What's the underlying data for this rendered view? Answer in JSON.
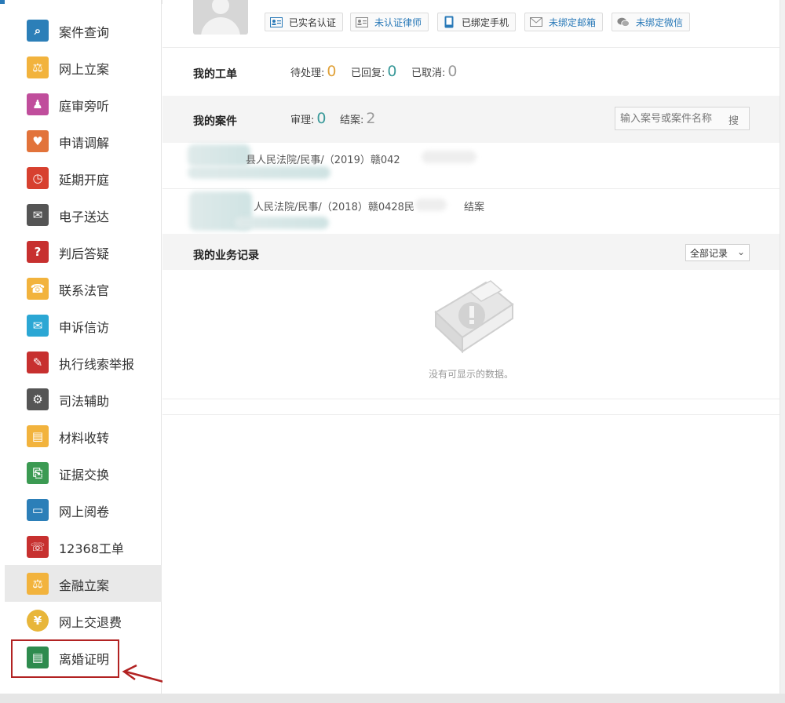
{
  "sidebar": {
    "items": [
      {
        "label": "案件查询",
        "icon": "magnifier-book-icon",
        "color": "#2c7fb8",
        "glyph": "⌕"
      },
      {
        "label": "网上立案",
        "icon": "gavel-icon",
        "color": "#f2b33d",
        "glyph": "⚖"
      },
      {
        "label": "庭审旁听",
        "icon": "audience-icon",
        "color": "#c04e9c",
        "glyph": "♟"
      },
      {
        "label": "申请调解",
        "icon": "handshake-heart-icon",
        "color": "#e2733a",
        "glyph": "♥"
      },
      {
        "label": "延期开庭",
        "icon": "clock-icon",
        "color": "#d7402f",
        "glyph": "◷"
      },
      {
        "label": "电子送达",
        "icon": "delivery-icon",
        "color": "#555555",
        "glyph": "✉"
      },
      {
        "label": "判后答疑",
        "icon": "question-icon",
        "color": "#c7302f",
        "glyph": "?"
      },
      {
        "label": "联系法官",
        "icon": "phone-icon",
        "color": "#f2b33d",
        "glyph": "☎"
      },
      {
        "label": "申诉信访",
        "icon": "mail-icon",
        "color": "#2ba7d4",
        "glyph": "✉"
      },
      {
        "label": "执行线索举报",
        "icon": "report-icon",
        "color": "#c7302f",
        "glyph": "✎"
      },
      {
        "label": "司法辅助",
        "icon": "assist-icon",
        "color": "#555555",
        "glyph": "⚙"
      },
      {
        "label": "材料收转",
        "icon": "materials-icon",
        "color": "#f2b33d",
        "glyph": "▤"
      },
      {
        "label": "证据交换",
        "icon": "evidence-icon",
        "color": "#3b9a52",
        "glyph": "⎘"
      },
      {
        "label": "网上阅卷",
        "icon": "monitor-icon",
        "color": "#2c7fb8",
        "glyph": "▭"
      },
      {
        "label": "12368工单",
        "icon": "hotline-icon",
        "color": "#c7302f",
        "glyph": "☏"
      },
      {
        "label": "金融立案",
        "icon": "gavel-finance-icon",
        "color": "#f2b33d",
        "glyph": "⚖"
      },
      {
        "label": "网上交退费",
        "icon": "coin-icon",
        "color": "#e8b63a",
        "glyph": "¥"
      },
      {
        "label": "离婚证明",
        "icon": "certificate-icon",
        "color": "#2e8b4e",
        "glyph": "▤"
      }
    ],
    "active_index": 15,
    "highlighted_index": 17
  },
  "header": {
    "badges": [
      {
        "label": "已实名认证",
        "icon": "id-card-icon",
        "state": "on"
      },
      {
        "label": "未认证律师",
        "icon": "lawyer-card-icon",
        "state": "off"
      },
      {
        "label": "已绑定手机",
        "icon": "phone-device-icon",
        "state": "on"
      },
      {
        "label": "未绑定邮箱",
        "icon": "envelope-icon",
        "state": "off"
      },
      {
        "label": "未绑定微信",
        "icon": "wechat-icon",
        "state": "off"
      }
    ]
  },
  "work_orders": {
    "title": "我的工单",
    "pending_label": "待处理:",
    "pending_value": "0",
    "replied_label": "已回复:",
    "replied_value": "0",
    "cancelled_label": "已取消:",
    "cancelled_value": "0"
  },
  "cases": {
    "title": "我的案件",
    "trial_label": "审理:",
    "trial_value": "0",
    "closed_label": "结案:",
    "closed_value": "2",
    "search_placeholder": "输入案号或案件名称",
    "search_button": "搜",
    "items": [
      {
        "text": "县人民法院/民事/（2019）赣042"
      },
      {
        "text": "人民法院/民事/（2018）赣0428民"
      },
      {
        "suffix": "结案"
      }
    ]
  },
  "records": {
    "title": "我的业务记录",
    "filter_value": "全部记录",
    "empty_text": "没有可显示的数据。"
  },
  "colors": {
    "accent_blue": "#2a7ab8",
    "highlight_red": "#b22222",
    "pending_orange": "#e0a23a",
    "replied_teal": "#3b9a9a"
  }
}
